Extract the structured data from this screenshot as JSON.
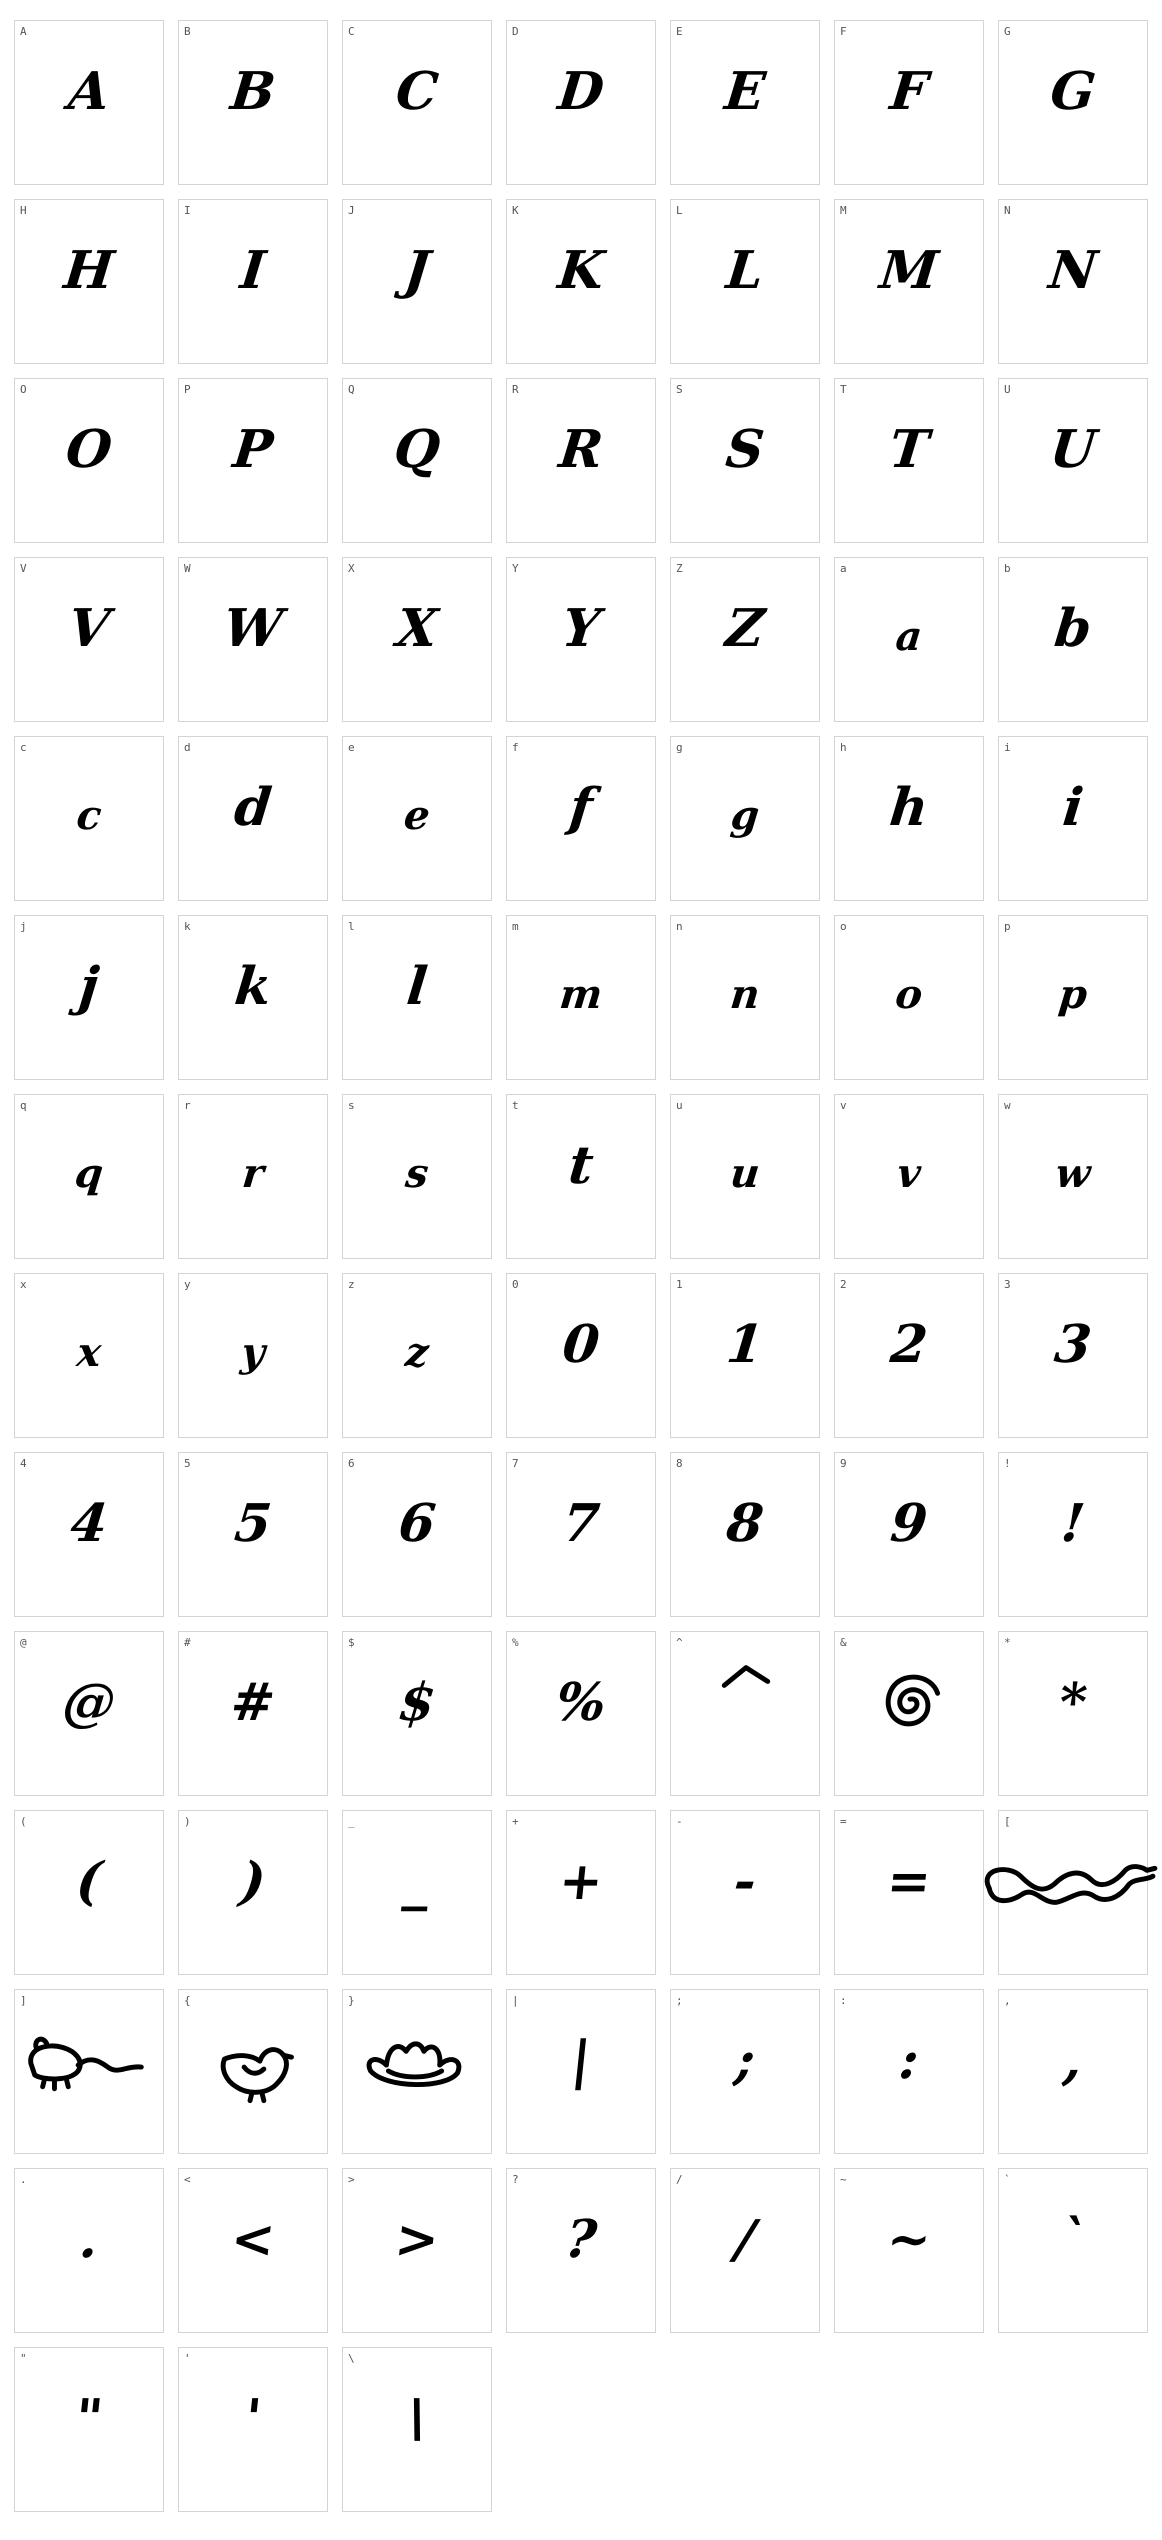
{
  "glyphs": [
    {
      "label": "A",
      "char": "A"
    },
    {
      "label": "B",
      "char": "B"
    },
    {
      "label": "C",
      "char": "C"
    },
    {
      "label": "D",
      "char": "D"
    },
    {
      "label": "E",
      "char": "E"
    },
    {
      "label": "F",
      "char": "F"
    },
    {
      "label": "G",
      "char": "G"
    },
    {
      "label": "H",
      "char": "H"
    },
    {
      "label": "I",
      "char": "I"
    },
    {
      "label": "J",
      "char": "J"
    },
    {
      "label": "K",
      "char": "K"
    },
    {
      "label": "L",
      "char": "L"
    },
    {
      "label": "M",
      "char": "M"
    },
    {
      "label": "N",
      "char": "N"
    },
    {
      "label": "O",
      "char": "O"
    },
    {
      "label": "P",
      "char": "P"
    },
    {
      "label": "Q",
      "char": "Q"
    },
    {
      "label": "R",
      "char": "R"
    },
    {
      "label": "S",
      "char": "S"
    },
    {
      "label": "T",
      "char": "T"
    },
    {
      "label": "U",
      "char": "U"
    },
    {
      "label": "V",
      "char": "V"
    },
    {
      "label": "W",
      "char": "W"
    },
    {
      "label": "X",
      "char": "X"
    },
    {
      "label": "Y",
      "char": "Y"
    },
    {
      "label": "Z",
      "char": "Z"
    },
    {
      "label": "a",
      "char": "a"
    },
    {
      "label": "b",
      "char": "b"
    },
    {
      "label": "c",
      "char": "c"
    },
    {
      "label": "d",
      "char": "d"
    },
    {
      "label": "e",
      "char": "e"
    },
    {
      "label": "f",
      "char": "f"
    },
    {
      "label": "g",
      "char": "g"
    },
    {
      "label": "h",
      "char": "h"
    },
    {
      "label": "i",
      "char": "i"
    },
    {
      "label": "j",
      "char": "j"
    },
    {
      "label": "k",
      "char": "k"
    },
    {
      "label": "l",
      "char": "l"
    },
    {
      "label": "m",
      "char": "m"
    },
    {
      "label": "n",
      "char": "n"
    },
    {
      "label": "o",
      "char": "o"
    },
    {
      "label": "p",
      "char": "p"
    },
    {
      "label": "q",
      "char": "q"
    },
    {
      "label": "r",
      "char": "r"
    },
    {
      "label": "s",
      "char": "s"
    },
    {
      "label": "t",
      "char": "t"
    },
    {
      "label": "u",
      "char": "u"
    },
    {
      "label": "v",
      "char": "v"
    },
    {
      "label": "w",
      "char": "w"
    },
    {
      "label": "x",
      "char": "x"
    },
    {
      "label": "y",
      "char": "y"
    },
    {
      "label": "z",
      "char": "z"
    },
    {
      "label": "0",
      "char": "0"
    },
    {
      "label": "1",
      "char": "1"
    },
    {
      "label": "2",
      "char": "2"
    },
    {
      "label": "3",
      "char": "3"
    },
    {
      "label": "4",
      "char": "4"
    },
    {
      "label": "5",
      "char": "5"
    },
    {
      "label": "6",
      "char": "6"
    },
    {
      "label": "7",
      "char": "7"
    },
    {
      "label": "8",
      "char": "8"
    },
    {
      "label": "9",
      "char": "9"
    },
    {
      "label": "!",
      "char": "!"
    },
    {
      "label": "@",
      "char": "@"
    },
    {
      "label": "#",
      "char": "#"
    },
    {
      "label": "$",
      "char": "$"
    },
    {
      "label": "%",
      "char": "%"
    },
    {
      "label": "^",
      "char": "^",
      "icon": "caret-icon"
    },
    {
      "label": "&",
      "char": "",
      "icon": "spiral-icon"
    },
    {
      "label": "*",
      "char": "*"
    },
    {
      "label": "(",
      "char": "("
    },
    {
      "label": ")",
      "char": ")"
    },
    {
      "label": "_",
      "char": "_"
    },
    {
      "label": "+",
      "char": "+"
    },
    {
      "label": "-",
      "char": "-"
    },
    {
      "label": "=",
      "char": "="
    },
    {
      "label": "[",
      "char": "",
      "icon": "snake-icon"
    },
    {
      "label": "]",
      "char": "",
      "icon": "mouse-icon"
    },
    {
      "label": "{",
      "char": "",
      "icon": "bird-icon"
    },
    {
      "label": "}",
      "char": "",
      "icon": "hat-icon"
    },
    {
      "label": "|",
      "char": "|"
    },
    {
      "label": ";",
      "char": ";"
    },
    {
      "label": ":",
      "char": ":"
    },
    {
      "label": ",",
      "char": ","
    },
    {
      "label": ".",
      "char": "."
    },
    {
      "label": "<",
      "char": "<"
    },
    {
      "label": ">",
      "char": ">"
    },
    {
      "label": "?",
      "char": "?"
    },
    {
      "label": "/",
      "char": "/"
    },
    {
      "label": "~",
      "char": "~"
    },
    {
      "label": "`",
      "char": "`"
    },
    {
      "label": "\"",
      "char": "\""
    },
    {
      "label": "'",
      "char": "'"
    },
    {
      "label": "\\",
      "char": "\\"
    }
  ]
}
